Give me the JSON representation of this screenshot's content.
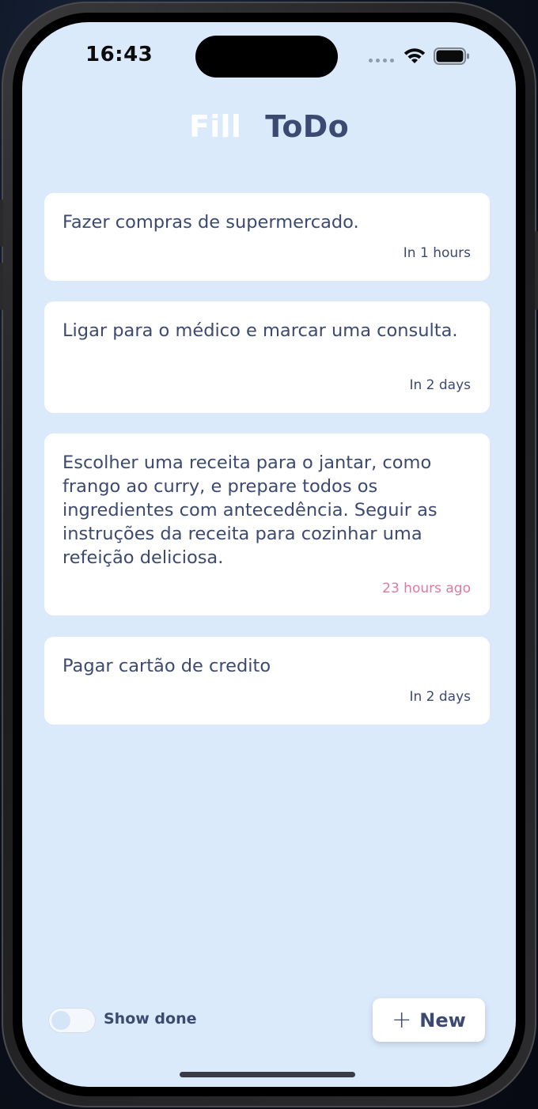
{
  "status_bar": {
    "time": "16:43"
  },
  "header": {
    "part1": "Fill",
    "part2": "ToDo"
  },
  "tasks": [
    {
      "text": "Fazer compras de supermercado.",
      "time": "In 1 hours",
      "overdue": false
    },
    {
      "text": "Ligar para o médico e marcar uma consulta.",
      "time": "In 2 days",
      "overdue": false
    },
    {
      "text": "Escolher uma receita para o jantar, como frango ao curry, e prepare todos os ingredientes com antecedência. Seguir as instruções da receita para cozinhar uma refeição deliciosa.",
      "time": "23 hours ago",
      "overdue": true
    },
    {
      "text": "Pagar cartão de credito",
      "time": "In 2 days",
      "overdue": false
    }
  ],
  "footer": {
    "toggle_label": "Show done",
    "toggle_on": false,
    "new_button_icon": "plus-icon",
    "new_button_label": "New"
  },
  "colors": {
    "background": "#dbeafb",
    "primary_text": "#3c4a72",
    "overdue": "#e07a9a",
    "card": "#ffffff"
  }
}
